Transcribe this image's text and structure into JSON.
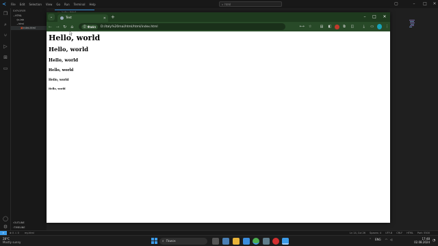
{
  "vscode": {
    "menu": [
      "File",
      "Edit",
      "Selection",
      "View",
      "Go",
      "Run",
      "Terminal",
      "Help"
    ],
    "search_placeholder": "html",
    "explorer_title": "EXPLORER",
    "tree": [
      {
        "label": "HTML",
        "level": 0
      },
      {
        "label": "js-lab",
        "level": 1
      },
      {
        "label": "html",
        "level": 1
      },
      {
        "label": "index.html",
        "level": 2
      }
    ],
    "outline_label": "OUTLINE",
    "timeline_label": "TIMELINE",
    "editor_tab": "index.html",
    "status_left": "⊗ 0 ⚠ 0",
    "status_branch": "my.html",
    "status_right": [
      "Ln 14, Col 26",
      "Spaces: 4",
      "UTF-8",
      "CRLF",
      "HTML",
      "Port: 5500"
    ]
  },
  "chrome": {
    "tab_title": "Test",
    "file_chip": "Файл",
    "url": "D:/italy%20mai/html/html/index.html",
    "win_controls": {
      "minimize": "–",
      "maximize": "□",
      "close": "✕"
    },
    "accent": "#1e3a1e"
  },
  "page": {
    "h1": "Hello, world",
    "h2": "Hello, world",
    "h3": "Hello, world",
    "h4": "Hello, world",
    "h5": "Hello, world",
    "h6": "Hello, world"
  },
  "taskbar": {
    "weather_temp": "28°C",
    "weather_desc": "Mostly sunny",
    "search_placeholder": "Поиск",
    "lang": "ENG",
    "time": "17:48",
    "date": "02.08.2024"
  }
}
